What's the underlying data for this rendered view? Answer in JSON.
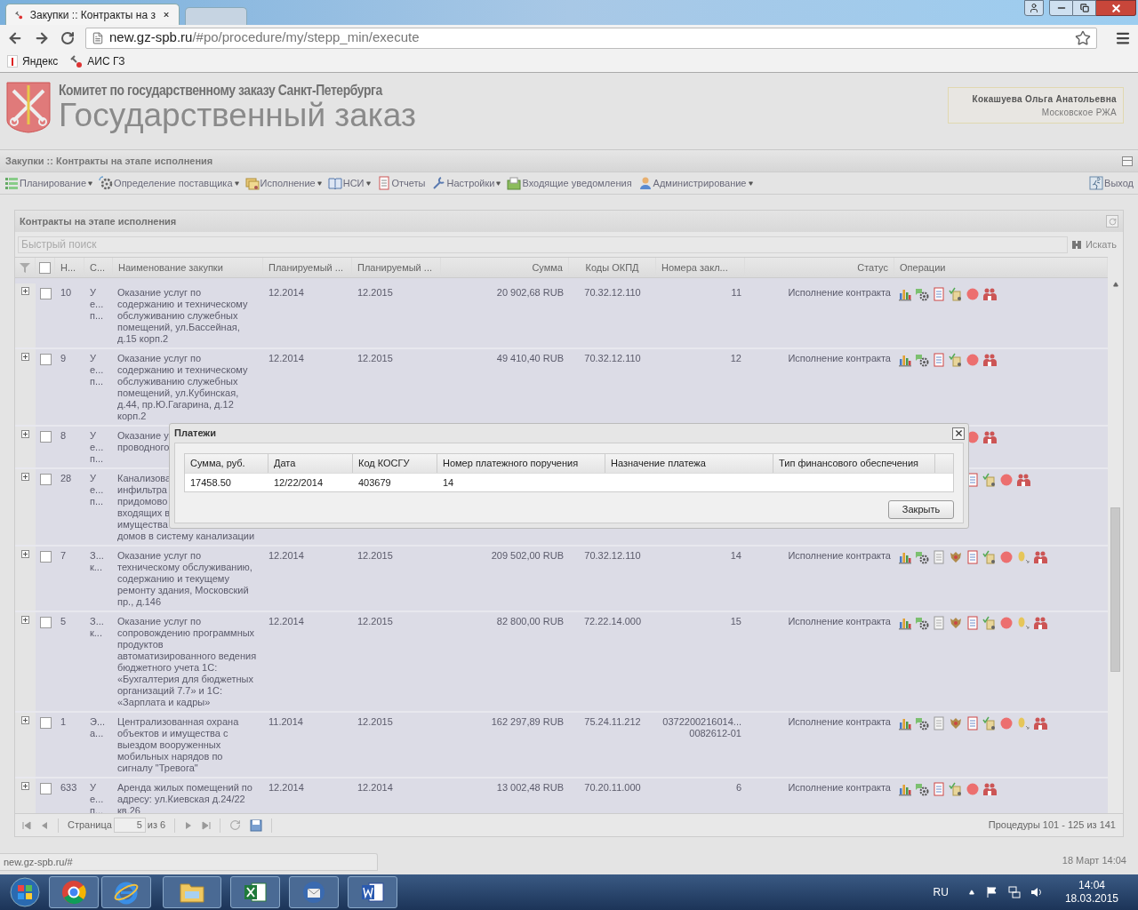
{
  "browser": {
    "tabs": [
      {
        "label": "Закупки :: Контракты на з",
        "selected": true
      },
      {
        "selected": false
      }
    ],
    "url_host": "new.gz-spb.ru",
    "url_path": "/#po/procedure/my/stepp_min/execute",
    "bookmarks": [
      "Яндекс",
      "АИС ГЗ"
    ]
  },
  "header": {
    "org": "Комитет по государственному заказу Санкт-Петербурга",
    "title": "Государственный заказ",
    "user_name": "Кокашуева Ольга Анатольевна",
    "user_org": "Московское РЖА"
  },
  "breadcrumb": "Закупки :: Контракты на этапе исполнения",
  "menu": [
    {
      "label": "Планирование",
      "dropdown": true,
      "kind": "plan"
    },
    {
      "label": "Определение поставщика",
      "dropdown": true,
      "kind": "gear"
    },
    {
      "label": "Исполнение",
      "dropdown": true,
      "kind": "exec"
    },
    {
      "label": "НСИ",
      "dropdown": true,
      "kind": "book"
    },
    {
      "label": "Отчеты",
      "dropdown": false,
      "kind": "report"
    },
    {
      "label": "Настройки",
      "dropdown": true,
      "kind": "wrench"
    },
    {
      "label": "Входящие уведомления",
      "dropdown": false,
      "kind": "inbox"
    },
    {
      "label": "Администрирование",
      "dropdown": true,
      "kind": "admin"
    }
  ],
  "logout": "Выход",
  "panel": {
    "title": "Контракты на этапе исполнения",
    "search_placeholder": "Быстрый поиск",
    "search_button": "Искать"
  },
  "table": {
    "header_checked": false,
    "columns": [
      "Н...",
      "С...",
      "Наименование закупки",
      "Планируемый ...",
      "Планируемый ...",
      "Сумма",
      "Коды ОКПД",
      "Номера закл...",
      "Статус",
      "Операции"
    ],
    "rows": [
      {
        "checked": false,
        "n": "10",
        "c": "У\nе...\nп...",
        "name": "Оказание услуг по\nсодержанию и техническому\nобслуживанию служебных\nпомещений, ул.Бассейная,\nд.15 корп.2",
        "plan_start": "12.2014",
        "plan_end": "12.2015",
        "sum": "20 902,68 RUB",
        "okpd": "70.32.12.110",
        "numbers": "11",
        "status": "Исполнение контракта",
        "ops": [
          {
            "kind": "chart"
          },
          {
            "kind": "gear"
          },
          {
            "kind": "doc"
          },
          {
            "kind": "check"
          },
          {
            "kind": "stop"
          },
          {
            "kind": "people"
          }
        ]
      },
      {
        "checked": false,
        "n": "9",
        "c": "У\nе...\nп...",
        "name": "Оказание услуг по\nсодержанию и техническому\nобслуживанию служебных\nпомещений, ул.Кубинская,\nд.44, пр.Ю.Гагарина, д.12\nкорп.2",
        "plan_start": "12.2014",
        "plan_end": "12.2015",
        "sum": "49 410,40 RUB",
        "okpd": "70.32.12.110",
        "numbers": "12",
        "status": "Исполнение контракта",
        "ops": [
          {
            "kind": "chart"
          },
          {
            "kind": "gear"
          },
          {
            "kind": "doc"
          },
          {
            "kind": "check"
          },
          {
            "kind": "stop"
          },
          {
            "kind": "people"
          }
        ]
      },
      {
        "checked": false,
        "n": "8",
        "c": "У\nе...\nп...",
        "name": "Оказание у\nпроводного",
        "ops": [
          {
            "kind": "gap"
          },
          {
            "kind": "gap"
          },
          {
            "kind": "gap"
          },
          {
            "kind": "gap"
          },
          {
            "kind": "stop"
          },
          {
            "kind": "people"
          }
        ]
      },
      {
        "checked": false,
        "n": "28",
        "c": "У\nе...\nп...",
        "name": [
          "Канализова\nинфильтра\nпридомово\nвходящих в\nимущества",
          "домов в систему канализации"
        ],
        "ops": [
          {
            "kind": "gap"
          },
          {
            "kind": "gap"
          },
          {
            "kind": "gap"
          },
          {
            "kind": "gap"
          },
          {
            "kind": "doc"
          },
          {
            "kind": "check"
          },
          {
            "kind": "stop"
          },
          {
            "kind": "people"
          }
        ]
      },
      {
        "checked": false,
        "n": "7",
        "c": "З...\nк...",
        "name": "Оказание услуг по\nтехническому обслуживанию,\nсодержанию и текущему\nремонту здания, Московский\nпр., д.146",
        "plan_start": "12.2014",
        "plan_end": "12.2015",
        "sum": "209 502,00 RUB",
        "okpd": "70.32.12.110",
        "numbers": "14",
        "status": "Исполнение контракта",
        "ops": [
          {
            "kind": "chart"
          },
          {
            "kind": "gear"
          },
          {
            "kind": "sheet"
          },
          {
            "kind": "emblem"
          },
          {
            "kind": "doc"
          },
          {
            "kind": "check"
          },
          {
            "kind": "stop"
          },
          {
            "kind": "coin"
          },
          {
            "kind": "people"
          }
        ]
      },
      {
        "checked": false,
        "n": "5",
        "c": "З...\nк...",
        "name": "Оказание услуг по\nсопровождению программных\nпродуктов\nавтоматизированного ведения\nбюджетного учета 1С:\n«Бухгалтерия для бюджетных\nорганизаций 7.7» и 1С:\n«Зарплата и кадры»",
        "plan_start": "12.2014",
        "plan_end": "12.2015",
        "sum": "82 800,00 RUB",
        "okpd": "72.22.14.000",
        "numbers": "15",
        "status": "Исполнение контракта",
        "ops": [
          {
            "kind": "chart"
          },
          {
            "kind": "gear"
          },
          {
            "kind": "sheet"
          },
          {
            "kind": "emblem"
          },
          {
            "kind": "doc"
          },
          {
            "kind": "check"
          },
          {
            "kind": "stop"
          },
          {
            "kind": "coin"
          },
          {
            "kind": "people"
          }
        ]
      },
      {
        "checked": false,
        "n": "1",
        "c": "Э...\nа...",
        "name": "Централизованная охрана\nобъектов и имущества с\nвыездом вооруженных\nмобильных нарядов по\nсигналу \"Тревога\"",
        "plan_start": "11.2014",
        "plan_end": "12.2015",
        "sum": "162 297,89 RUB",
        "okpd": "75.24.11.212",
        "numbers": "0372200216014...\n0082612-01",
        "status": "Исполнение контракта",
        "ops": [
          {
            "kind": "chart"
          },
          {
            "kind": "gear"
          },
          {
            "kind": "sheet"
          },
          {
            "kind": "emblem"
          },
          {
            "kind": "doc"
          },
          {
            "kind": "check"
          },
          {
            "kind": "stop"
          },
          {
            "kind": "coin"
          },
          {
            "kind": "people"
          }
        ]
      },
      {
        "checked": false,
        "n": "633",
        "c": "У\nе...\nп...",
        "name": "Аренда жилых помещений по\nадресу: ул.Киевская д.24/22\nкв.26",
        "plan_start": "12.2014",
        "plan_end": "12.2014",
        "sum": "13 002,48 RUB",
        "okpd": "70.20.11.000",
        "numbers": "6",
        "status": "Исполнение контракта",
        "ops": [
          {
            "kind": "chart"
          },
          {
            "kind": "gear"
          },
          {
            "kind": "doc"
          },
          {
            "kind": "check"
          },
          {
            "kind": "stop"
          },
          {
            "kind": "people"
          }
        ]
      }
    ]
  },
  "pager": {
    "page_label": "Страница",
    "page": "5",
    "of": "из 6",
    "summary": "Процедуры 101 - 125 из 141"
  },
  "dialog": {
    "title": "Платежи",
    "columns": [
      "Сумма, руб.",
      "Дата",
      "Код КОСГУ",
      "Номер платежного поручения",
      "Назначение платежа",
      "Тип финансового обеспечения"
    ],
    "rows": [
      [
        "17458.50",
        "12/22/2014",
        "403679",
        "14"
      ]
    ],
    "button": "Закрыть"
  },
  "status_url": "new.gz-spb.ru/#",
  "datetime_label": "18 Март 14:04",
  "taskbar": {
    "language": "RU",
    "time": "14:04",
    "date": "18.03.2015"
  }
}
